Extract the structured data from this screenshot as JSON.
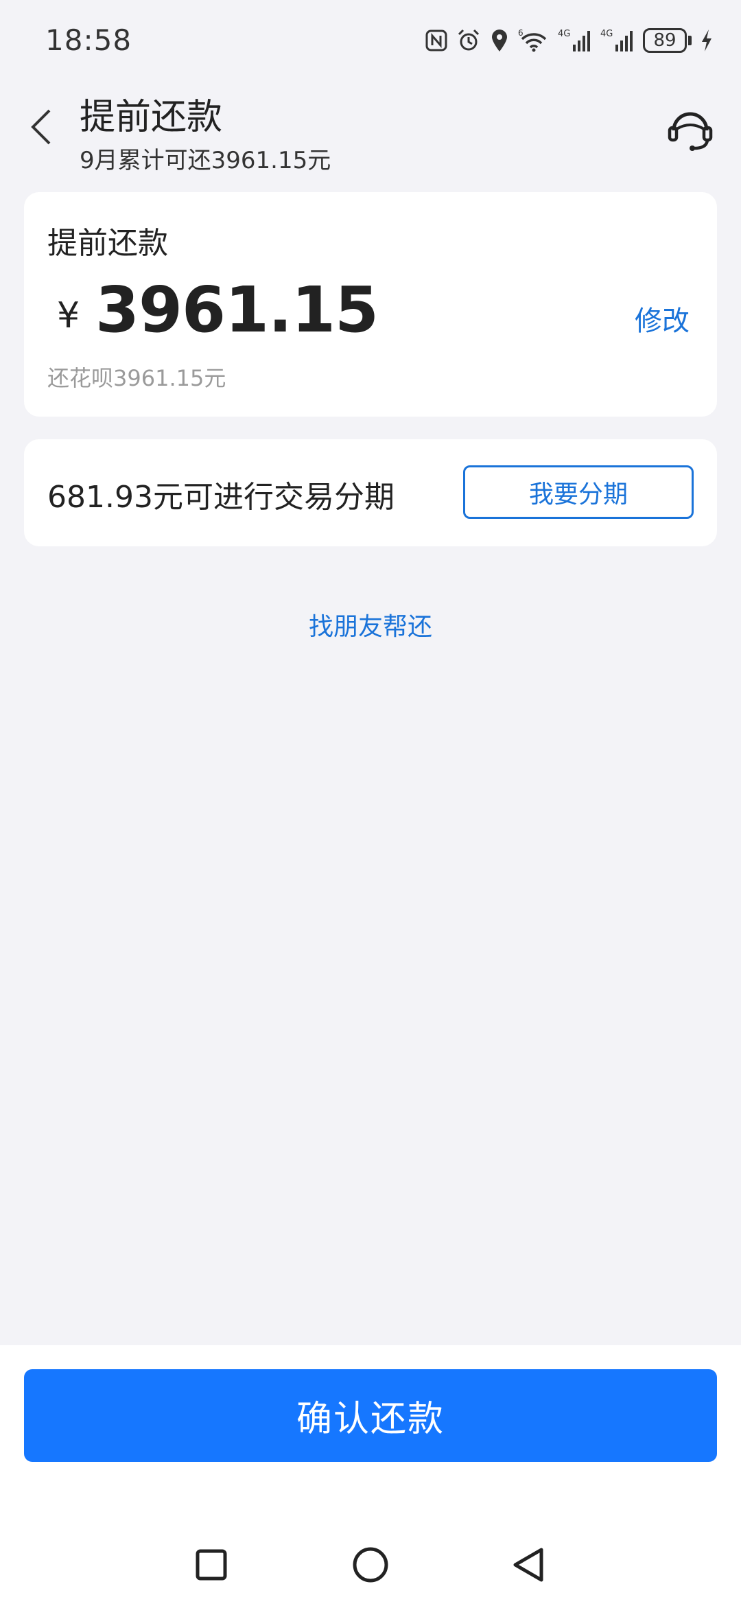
{
  "status_bar": {
    "time": "18:58",
    "battery": "89",
    "icons": [
      "nfc-icon",
      "alarm-icon",
      "location-icon",
      "wifi-icon",
      "signal-4g-icon",
      "signal-4g-icon",
      "battery-icon",
      "charging-icon"
    ]
  },
  "header": {
    "title": "提前还款",
    "subtitle": "9月累计可还3961.15元",
    "back_icon": "back-arrow-icon",
    "service_icon": "customer-service-icon"
  },
  "amount_card": {
    "label": "提前还款",
    "currency": "¥",
    "amount": "3961.15",
    "edit_label": "修改",
    "note": "还花呗3961.15元"
  },
  "installment_card": {
    "text": "681.93元可进行交易分期",
    "button_label": "我要分期"
  },
  "friend_link": "找朋友帮还",
  "confirm_button": "确认还款",
  "colors": {
    "accent": "#1677ff",
    "link": "#1a73d9",
    "background": "#f3f3f7"
  },
  "nav_bar": [
    "recents-square-icon",
    "home-circle-icon",
    "back-triangle-icon"
  ]
}
